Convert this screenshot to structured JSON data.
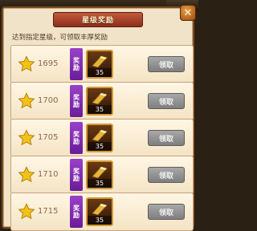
{
  "dialog": {
    "title": "星级奖励",
    "close_glyph": "✕",
    "intro": "达到指定星级，可领取丰厚奖励"
  },
  "rows": [
    {
      "level": "1695",
      "tag": "奖励",
      "quantity": "35",
      "claim_label": "领取"
    },
    {
      "level": "1700",
      "tag": "奖励",
      "quantity": "35",
      "claim_label": "领取"
    },
    {
      "level": "1705",
      "tag": "奖励",
      "quantity": "35",
      "claim_label": "领取"
    },
    {
      "level": "1710",
      "tag": "奖励",
      "quantity": "35",
      "claim_label": "领取"
    },
    {
      "level": "1715",
      "tag": "奖励",
      "quantity": "35",
      "claim_label": "领取"
    }
  ],
  "icons": {
    "star": "star-icon",
    "item": "gold-scroll-icon",
    "close": "close-icon"
  },
  "colors": {
    "panel_bg": "#f1e3c7",
    "title_bg": "#b04a30",
    "tag_purple": "#8a30b8",
    "claim_disabled": "#929292",
    "star_gold": "#f2c21a"
  }
}
